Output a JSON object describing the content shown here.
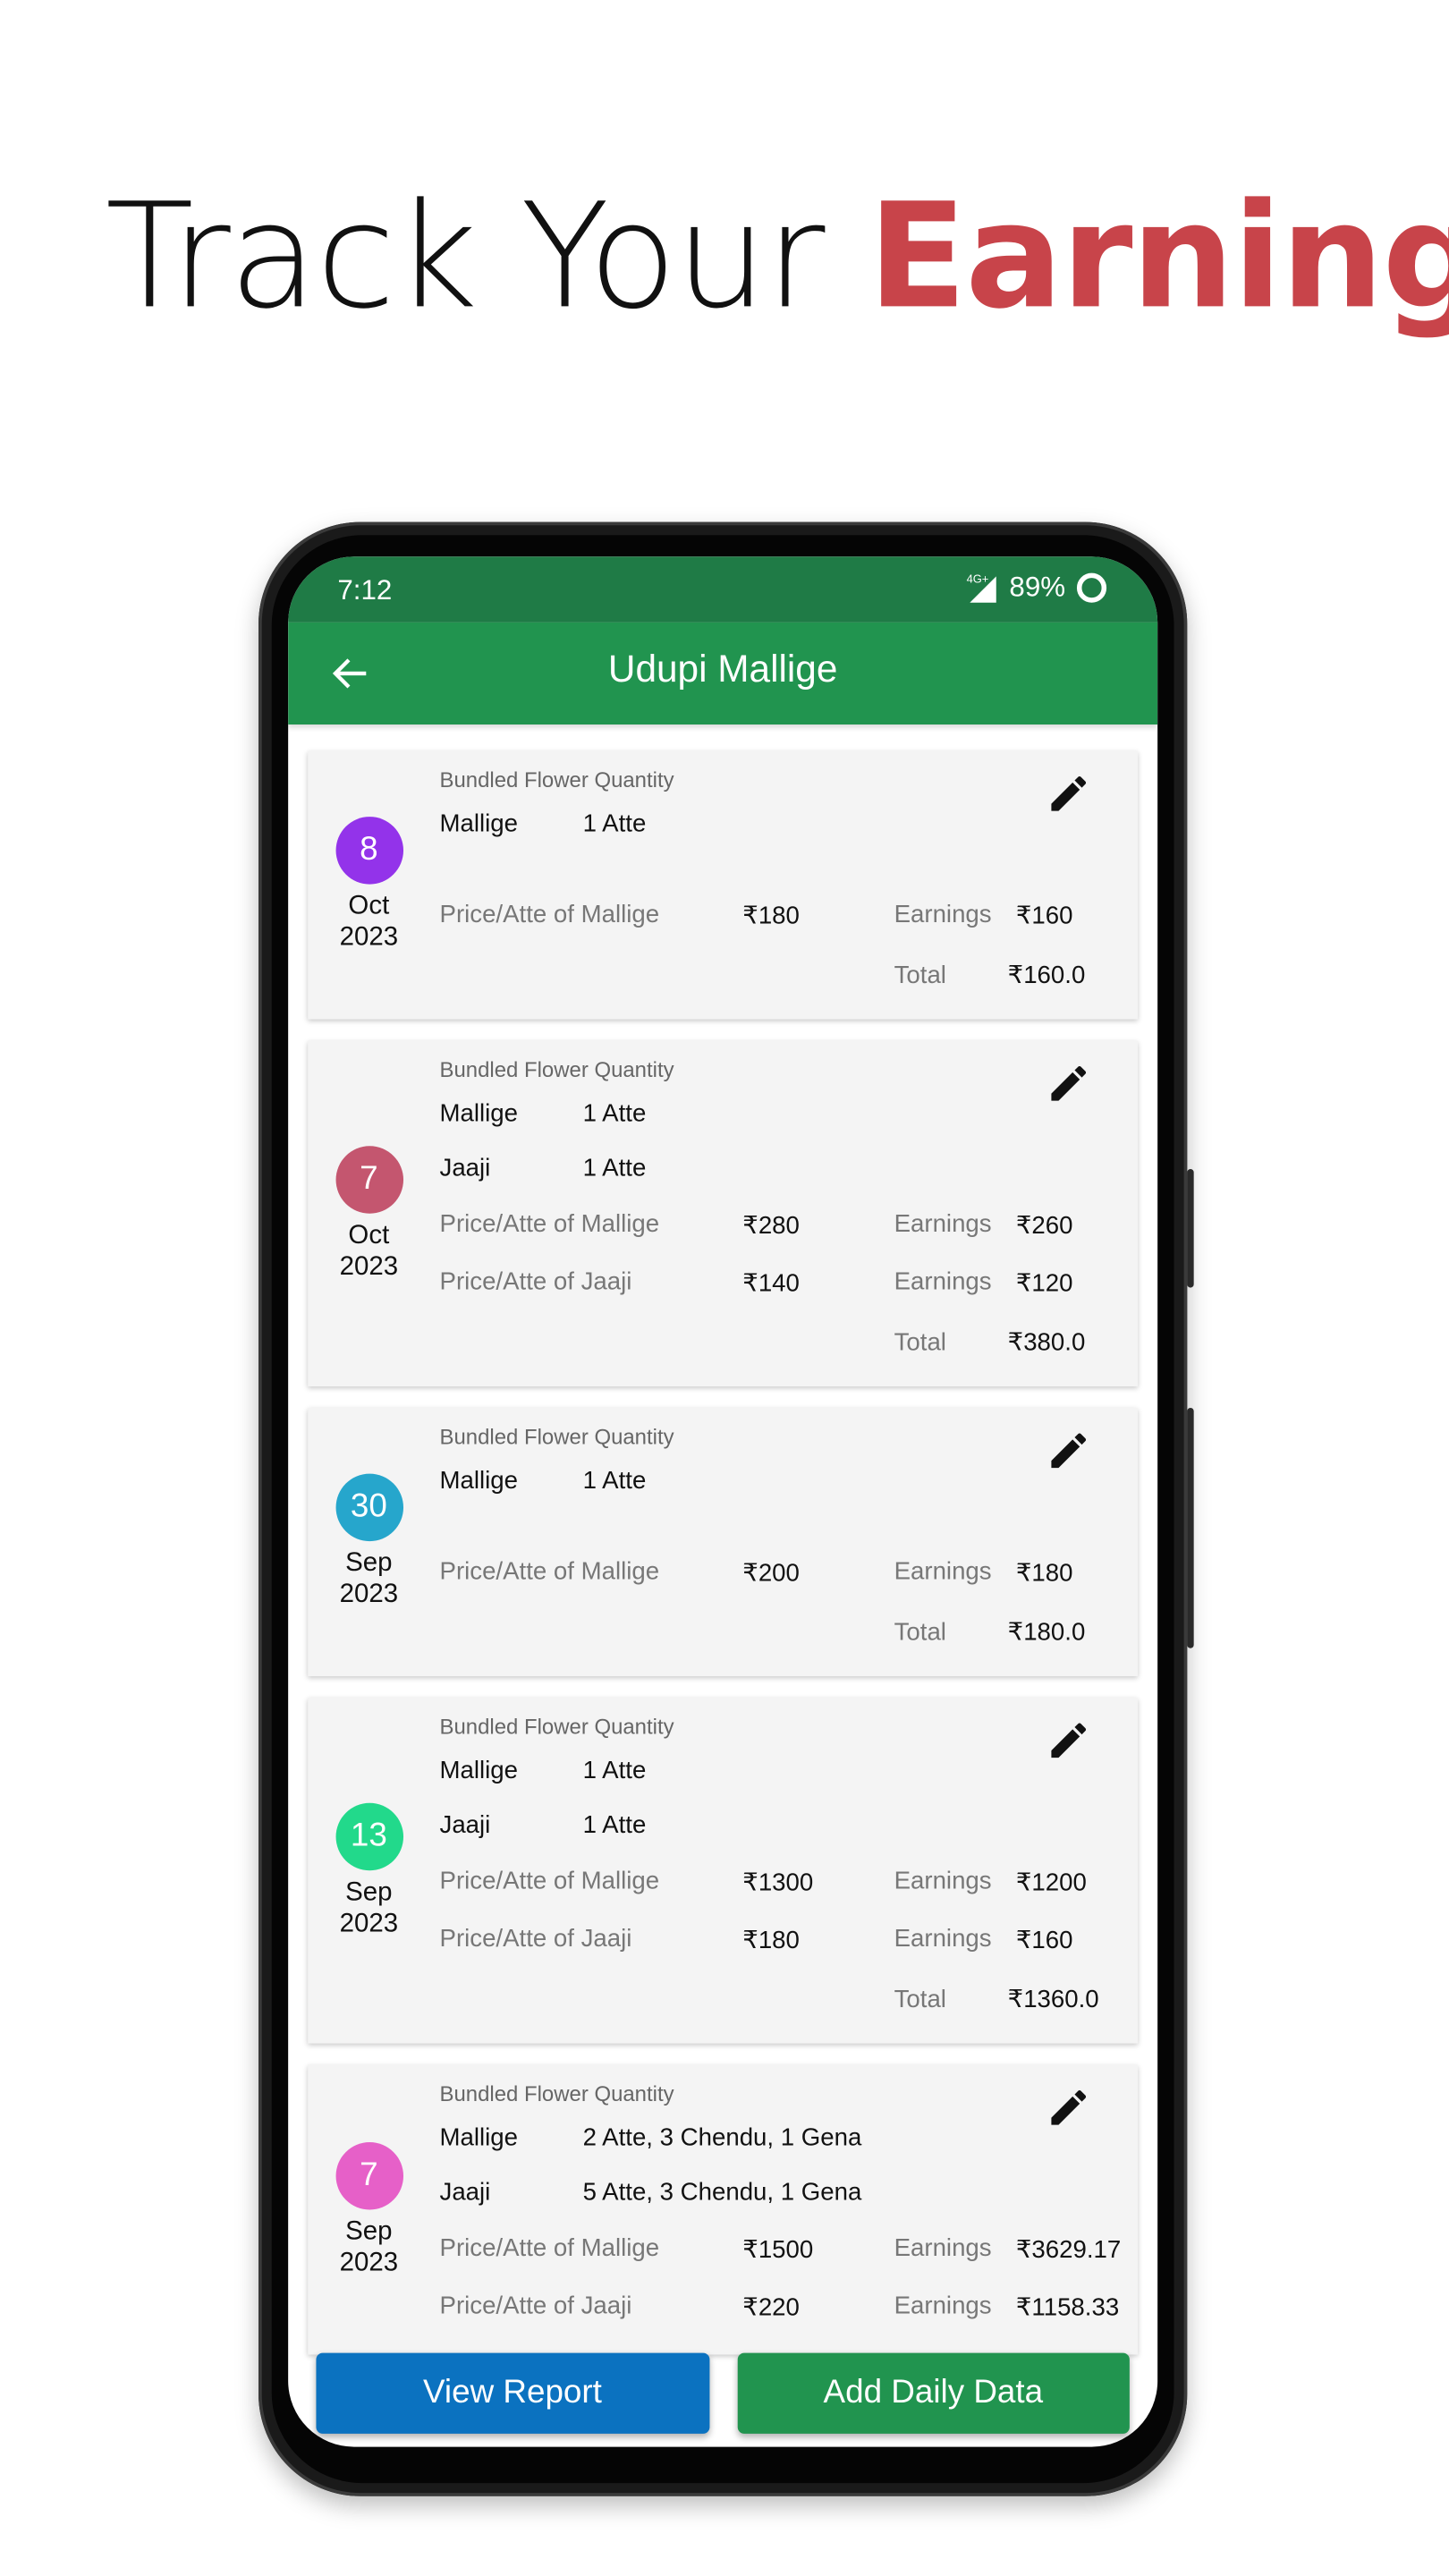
{
  "headline": {
    "prefix": "Track Your ",
    "accent": "Earnings",
    "accent_color": "#c8444a"
  },
  "status_bar": {
    "time": "7:12",
    "network": "4G+",
    "battery": "89%"
  },
  "app_bar": {
    "title": "Udupi Mallige",
    "back_icon": "arrow-left-icon",
    "color": "#21944f"
  },
  "quantity_label": "Bundled Flower Quantity",
  "total_label": "Total",
  "earnings_label": "Earnings",
  "entries": [
    {
      "day": "8",
      "month": "Oct",
      "year": "2023",
      "color": "#9333ea",
      "quantities": [
        {
          "flower": "Mallige",
          "qty": "1 Atte"
        }
      ],
      "prices": [
        {
          "label": "Price/Atte of Mallige",
          "price": "₹180",
          "earnings": "₹160"
        }
      ],
      "total": "₹160.0"
    },
    {
      "day": "7",
      "month": "Oct",
      "year": "2023",
      "color": "#c4566f",
      "quantities": [
        {
          "flower": "Mallige",
          "qty": "1 Atte"
        },
        {
          "flower": "Jaaji",
          "qty": "1 Atte"
        }
      ],
      "prices": [
        {
          "label": "Price/Atte of Mallige",
          "price": "₹280",
          "earnings": "₹260"
        },
        {
          "label": "Price/Atte of Jaaji",
          "price": "₹140",
          "earnings": "₹120"
        }
      ],
      "total": "₹380.0"
    },
    {
      "day": "30",
      "month": "Sep",
      "year": "2023",
      "color": "#26a6cc",
      "quantities": [
        {
          "flower": "Mallige",
          "qty": "1 Atte"
        }
      ],
      "prices": [
        {
          "label": "Price/Atte of Mallige",
          "price": "₹200",
          "earnings": "₹180"
        }
      ],
      "total": "₹180.0"
    },
    {
      "day": "13",
      "month": "Sep",
      "year": "2023",
      "color": "#22d98b",
      "quantities": [
        {
          "flower": "Mallige",
          "qty": "1 Atte"
        },
        {
          "flower": "Jaaji",
          "qty": "1 Atte"
        }
      ],
      "prices": [
        {
          "label": "Price/Atte of Mallige",
          "price": "₹1300",
          "earnings": "₹1200"
        },
        {
          "label": "Price/Atte of Jaaji",
          "price": "₹180",
          "earnings": "₹160"
        }
      ],
      "total": "₹1360.0"
    },
    {
      "day": "7",
      "month": "Sep",
      "year": "2023",
      "color": "#e660c8",
      "quantities": [
        {
          "flower": "Mallige",
          "qty": "2 Atte, 3 Chendu, 1 Gena"
        },
        {
          "flower": "Jaaji",
          "qty": "5 Atte, 3 Chendu, 1 Gena"
        }
      ],
      "prices": [
        {
          "label": "Price/Atte of Mallige",
          "price": "₹1500",
          "earnings": "₹3629.17"
        },
        {
          "label": "Price/Atte of Jaaji",
          "price": "₹220",
          "earnings": "₹1158.33"
        }
      ],
      "total": null
    }
  ],
  "buttons": {
    "view_report": "View Report",
    "view_report_color": "#0b72c0",
    "add_daily": "Add Daily Data",
    "add_daily_color": "#21944f"
  }
}
